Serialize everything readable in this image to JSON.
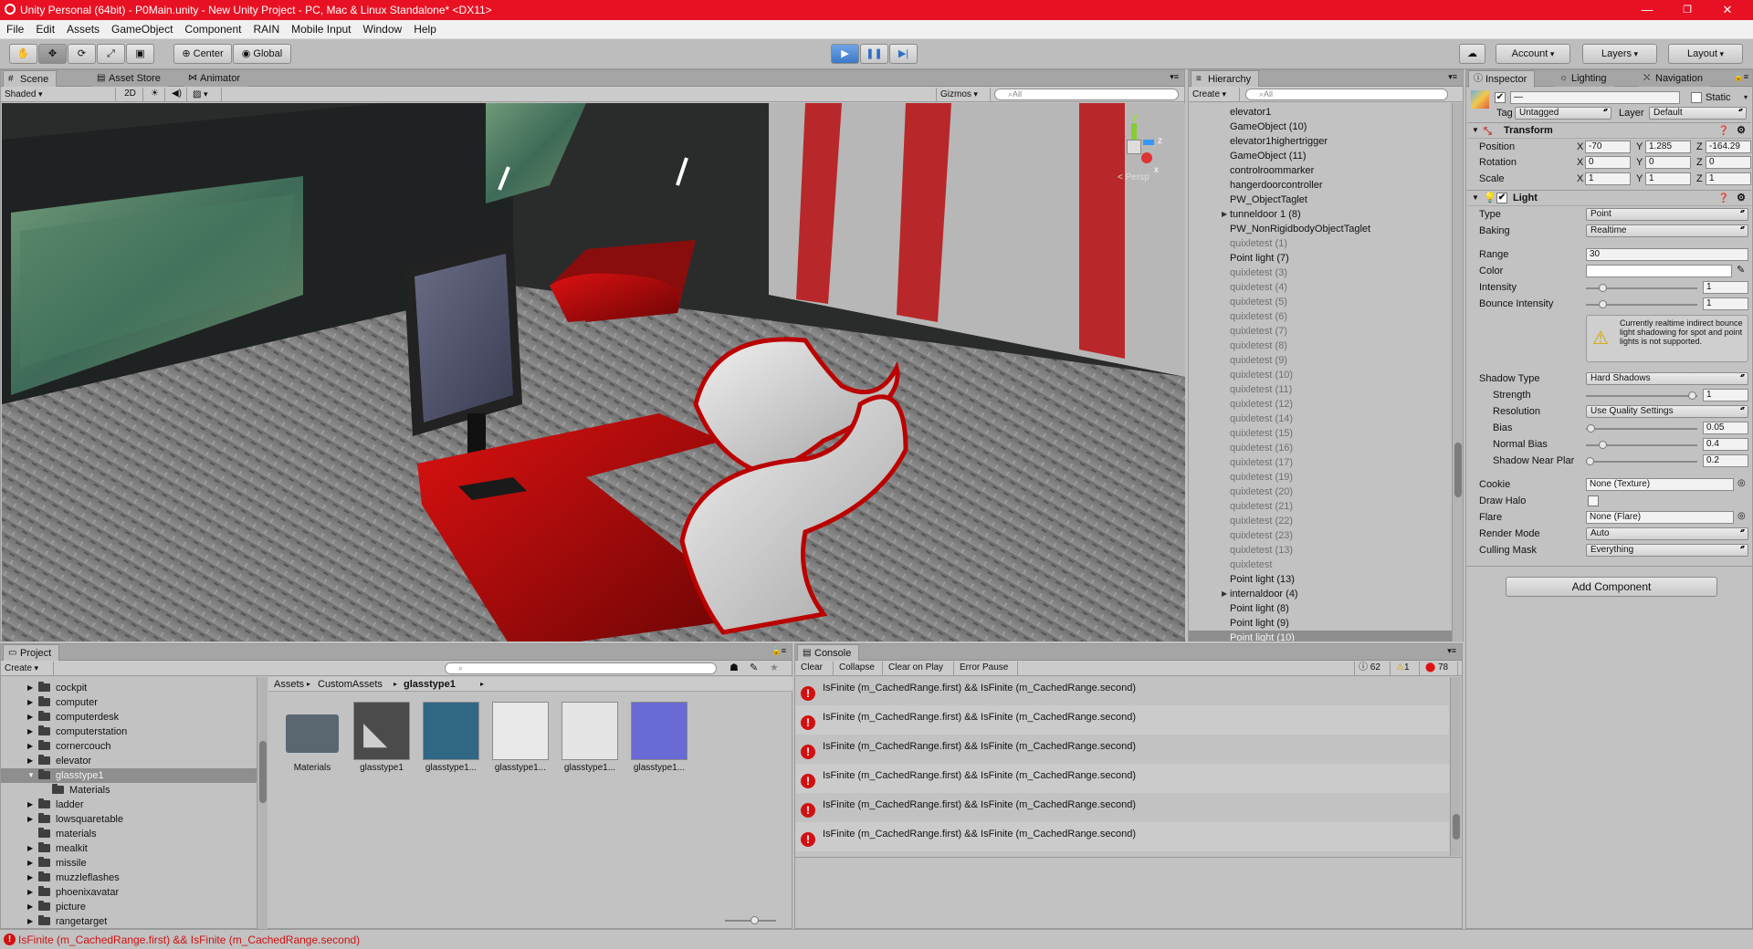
{
  "window": {
    "title": "Unity Personal (64bit) - P0Main.unity - New Unity Project - PC, Mac & Linux Standalone* <DX11>",
    "minimize": "—",
    "restore": "❐",
    "close": "✕"
  },
  "menu": [
    "File",
    "Edit",
    "Assets",
    "GameObject",
    "Component",
    "RAIN",
    "Mobile Input",
    "Window",
    "Help"
  ],
  "toolbar": {
    "pivot": "Center",
    "space": "Global",
    "account": "Account",
    "layers": "Layers",
    "layout": "Layout",
    "play_icon": "play-icon",
    "pause_icon": "pause-icon",
    "step_icon": "step-icon"
  },
  "scene": {
    "tabs": [
      "Scene",
      "Asset Store",
      "Animator"
    ],
    "shading": "Shaded",
    "mode_2d": "2D",
    "gizmos": "Gizmos",
    "search_placeholder": "All",
    "persp": "< Persp",
    "axis_y": "y",
    "axis_z": "z",
    "axis_x": "x"
  },
  "hierarchy": {
    "tab": "Hierarchy",
    "create": "Create",
    "search_placeholder": "All",
    "items": [
      {
        "label": "elevator1",
        "dim": false,
        "arrow": false
      },
      {
        "label": "GameObject (10)",
        "dim": false,
        "arrow": false
      },
      {
        "label": "elevator1highertrigger",
        "dim": false,
        "arrow": false
      },
      {
        "label": "GameObject (11)",
        "dim": false,
        "arrow": false
      },
      {
        "label": "controlroommarker",
        "dim": false,
        "arrow": false
      },
      {
        "label": "hangerdoorcontroller",
        "dim": false,
        "arrow": false
      },
      {
        "label": "PW_ObjectTaglet",
        "dim": false,
        "arrow": false
      },
      {
        "label": "tunneldoor 1 (8)",
        "dim": false,
        "arrow": true
      },
      {
        "label": "PW_NonRigidbodyObjectTaglet",
        "dim": false,
        "arrow": false
      },
      {
        "label": "quixletest (1)",
        "dim": true,
        "arrow": false
      },
      {
        "label": "Point light (7)",
        "dim": false,
        "arrow": false
      },
      {
        "label": "quixletest (3)",
        "dim": true,
        "arrow": false
      },
      {
        "label": "quixletest (4)",
        "dim": true,
        "arrow": false
      },
      {
        "label": "quixletest (5)",
        "dim": true,
        "arrow": false
      },
      {
        "label": "quixletest (6)",
        "dim": true,
        "arrow": false
      },
      {
        "label": "quixletest (7)",
        "dim": true,
        "arrow": false
      },
      {
        "label": "quixletest (8)",
        "dim": true,
        "arrow": false
      },
      {
        "label": "quixletest (9)",
        "dim": true,
        "arrow": false
      },
      {
        "label": "quixletest (10)",
        "dim": true,
        "arrow": false
      },
      {
        "label": "quixletest (11)",
        "dim": true,
        "arrow": false
      },
      {
        "label": "quixletest (12)",
        "dim": true,
        "arrow": false
      },
      {
        "label": "quixletest (14)",
        "dim": true,
        "arrow": false
      },
      {
        "label": "quixletest (15)",
        "dim": true,
        "arrow": false
      },
      {
        "label": "quixletest (16)",
        "dim": true,
        "arrow": false
      },
      {
        "label": "quixletest (17)",
        "dim": true,
        "arrow": false
      },
      {
        "label": "quixletest (19)",
        "dim": true,
        "arrow": false
      },
      {
        "label": "quixletest (20)",
        "dim": true,
        "arrow": false
      },
      {
        "label": "quixletest (21)",
        "dim": true,
        "arrow": false
      },
      {
        "label": "quixletest (22)",
        "dim": true,
        "arrow": false
      },
      {
        "label": "quixletest (23)",
        "dim": true,
        "arrow": false
      },
      {
        "label": "quixletest (13)",
        "dim": true,
        "arrow": false
      },
      {
        "label": "quixletest",
        "dim": true,
        "arrow": false
      },
      {
        "label": "Point light (13)",
        "dim": false,
        "arrow": false
      },
      {
        "label": "internaldoor (4)",
        "dim": false,
        "arrow": true
      },
      {
        "label": "Point light (8)",
        "dim": false,
        "arrow": false
      },
      {
        "label": "Point light (9)",
        "dim": false,
        "arrow": false
      },
      {
        "label": "Point light (10)",
        "dim": false,
        "arrow": false,
        "selected": true
      }
    ]
  },
  "inspector": {
    "tabs": [
      "Inspector",
      "Lighting",
      "Navigation"
    ],
    "object_name": "—",
    "static_label": "Static",
    "tag_label": "Tag",
    "tag_value": "Untagged",
    "layer_label": "Layer",
    "layer_value": "Default",
    "transform": {
      "title": "Transform",
      "position_label": "Position",
      "rotation_label": "Rotation",
      "scale_label": "Scale",
      "px": "-70",
      "py": "1.285",
      "pz": "-164.29",
      "rx": "0",
      "ry": "0",
      "rz": "0",
      "sx": "1",
      "sy": "1",
      "sz": "1",
      "x": "X",
      "y": "Y",
      "z": "Z"
    },
    "light": {
      "title": "Light",
      "type_label": "Type",
      "type_value": "Point",
      "baking_label": "Baking",
      "baking_value": "Realtime",
      "range_label": "Range",
      "range_value": "30",
      "color_label": "Color",
      "color_value": "#ffffff",
      "intensity_label": "Intensity",
      "intensity_value": "1",
      "bounce_label": "Bounce Intensity",
      "bounce_value": "1",
      "warning": "Currently realtime indirect bounce light shadowing for spot and point lights is not supported.",
      "shadow_type_label": "Shadow Type",
      "shadow_type_value": "Hard Shadows",
      "strength_label": "Strength",
      "strength_value": "1",
      "resolution_label": "Resolution",
      "resolution_value": "Use Quality Settings",
      "bias_label": "Bias",
      "bias_value": "0.05",
      "normal_bias_label": "Normal Bias",
      "normal_bias_value": "0.4",
      "near_plane_label": "Shadow Near Plar",
      "near_plane_value": "0.2",
      "cookie_label": "Cookie",
      "cookie_value": "None (Texture)",
      "halo_label": "Draw Halo",
      "flare_label": "Flare",
      "flare_value": "None (Flare)",
      "render_mode_label": "Render Mode",
      "render_mode_value": "Auto",
      "culling_label": "Culling Mask",
      "culling_value": "Everything"
    },
    "add_component": "Add Component"
  },
  "project": {
    "tab": "Project",
    "create": "Create",
    "folders": [
      {
        "label": "cockpit",
        "arrow": true
      },
      {
        "label": "computer",
        "arrow": true
      },
      {
        "label": "computerdesk",
        "arrow": true
      },
      {
        "label": "computerstation",
        "arrow": true
      },
      {
        "label": "cornercouch",
        "arrow": true
      },
      {
        "label": "elevator",
        "arrow": true
      },
      {
        "label": "glasstype1",
        "arrow": true,
        "selected": true
      },
      {
        "label": "Materials",
        "arrow": false,
        "indent": true
      },
      {
        "label": "ladder",
        "arrow": true
      },
      {
        "label": "lowsquaretable",
        "arrow": true
      },
      {
        "label": "materials",
        "arrow": false
      },
      {
        "label": "mealkit",
        "arrow": true
      },
      {
        "label": "missile",
        "arrow": true
      },
      {
        "label": "muzzleflashes",
        "arrow": true
      },
      {
        "label": "phoenixavatar",
        "arrow": true
      },
      {
        "label": "picture",
        "arrow": true
      },
      {
        "label": "rangetarget",
        "arrow": true
      }
    ],
    "breadcrumb": [
      "Assets",
      "CustomAssets",
      "glasstype1"
    ],
    "assets": [
      {
        "label": "Materials",
        "color": "#5a6670"
      },
      {
        "label": "glasstype1",
        "color": "#4b4b4b"
      },
      {
        "label": "glasstype1...",
        "color": "#2f6785"
      },
      {
        "label": "glasstype1...",
        "color": "#e9e9e9"
      },
      {
        "label": "glasstype1...",
        "color": "#e4e4e4"
      },
      {
        "label": "glasstype1...",
        "color": "#6a6ad4"
      }
    ]
  },
  "console": {
    "tab": "Console",
    "clear": "Clear",
    "collapse": "Collapse",
    "clear_on_play": "Clear on Play",
    "error_pause": "Error Pause",
    "info_count": "62",
    "warn_count": "1",
    "error_count": "78",
    "messages": [
      "IsFinite (m_CachedRange.first) && IsFinite (m_CachedRange.second)",
      "IsFinite (m_CachedRange.first) && IsFinite (m_CachedRange.second)",
      "IsFinite (m_CachedRange.first) && IsFinite (m_CachedRange.second)",
      "IsFinite (m_CachedRange.first) && IsFinite (m_CachedRange.second)",
      "IsFinite (m_CachedRange.first) && IsFinite (m_CachedRange.second)",
      "IsFinite (m_CachedRange.first) && IsFinite (m_CachedRange.second)"
    ]
  },
  "status": {
    "message": "IsFinite (m_CachedRange.first) && IsFinite (m_CachedRange.second)",
    "error_color": "#d11111"
  }
}
